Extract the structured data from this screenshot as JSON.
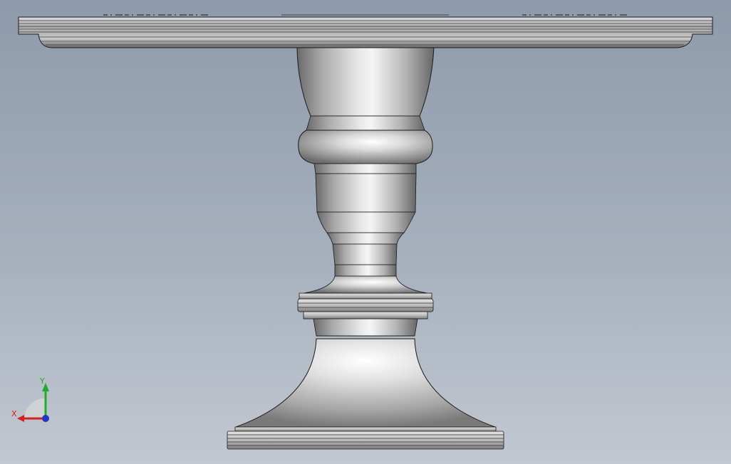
{
  "viewport": {
    "background_top": "#8e9aab",
    "background_bottom": "#c2c8d1"
  },
  "model": {
    "shading_light": "#f4f4f4",
    "shading_mid": "#c9c9c9",
    "shading_dark": "#5e5e5e",
    "edge_color": "#1a1a1a"
  },
  "triad": {
    "x_label": "X",
    "y_label": "Y",
    "x_color": "#d42020",
    "y_color": "#1fae2a",
    "z_color": "#2433c8"
  }
}
